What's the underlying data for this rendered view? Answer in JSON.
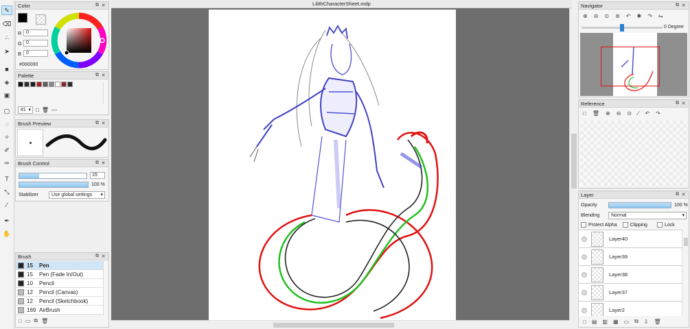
{
  "document": {
    "tab_title": "LilithCharacterSheet.mdp"
  },
  "toolbar": {
    "tools": [
      "pen-tool",
      "eraser-tool",
      "dot-tool",
      "select-arrow-tool",
      "fill-rect-tool",
      "bucket-tool",
      "gradient-tool",
      "rect-select-tool",
      "lasso-tool",
      "magic-wand-tool",
      "selection-pen-tool",
      "selection-eraser-tool",
      "text-tool",
      "transform-tool",
      "eyedropper-tool",
      "pipette-tool",
      "hand-tool"
    ]
  },
  "color_panel": {
    "title": "Color",
    "r_label": "R",
    "g_label": "G",
    "b_label": "B",
    "r": "0",
    "g": "0",
    "b": "0",
    "hex": "#000000",
    "fg_color": "#000000"
  },
  "palette_panel": {
    "title": "Palette",
    "colors": [
      "#111111",
      "#2a2a2a",
      "#1e1e1e",
      "#a32020",
      "#5c5c5c",
      "#888888",
      "#ffffff",
      "#8a2a2a",
      "#2b2b2b"
    ],
    "set_label": "#1",
    "dash": "---"
  },
  "brush_preview_panel": {
    "title": "Brush Preview"
  },
  "brush_control_panel": {
    "title": "Brush Control",
    "size_value": "15",
    "opacity_value": "100 %",
    "stabilizer_label": "Stabilizer",
    "stabilizer_value": "Use global settings",
    "size_fraction": 0.3,
    "opacity_fraction": 1.0
  },
  "brush_panel": {
    "title": "Brush",
    "items": [
      {
        "size": "15",
        "name": "Pen",
        "swatch": "#222222"
      },
      {
        "size": "15",
        "name": "Pen (Fade In/Out)",
        "swatch": "#222222"
      },
      {
        "size": "10",
        "name": "Pencil",
        "swatch": "#222222"
      },
      {
        "size": "12",
        "name": "Pencil (Canvas)",
        "swatch": "#bbbbbb"
      },
      {
        "size": "12",
        "name": "Pencil (Sketchbook)",
        "swatch": "#bbbbbb"
      },
      {
        "size": "169",
        "name": "AirBrush",
        "swatch": "#bbbbbb"
      }
    ]
  },
  "navigator_panel": {
    "title": "Navigator",
    "rotation": "0 Degree",
    "rotation_fraction": 0.5
  },
  "reference_panel": {
    "title": "Reference"
  },
  "layer_panel": {
    "title": "Layer",
    "opacity_label": "Opacity",
    "opacity_value": "100 %",
    "blending_label": "Blending",
    "blending_value": "Normal",
    "protect_alpha": "Protect Alpha",
    "clipping": "Clipping",
    "lock": "Lock",
    "layers": [
      "Layer40",
      "Layer39",
      "Layer38",
      "Layer37",
      "Layer2"
    ]
  }
}
